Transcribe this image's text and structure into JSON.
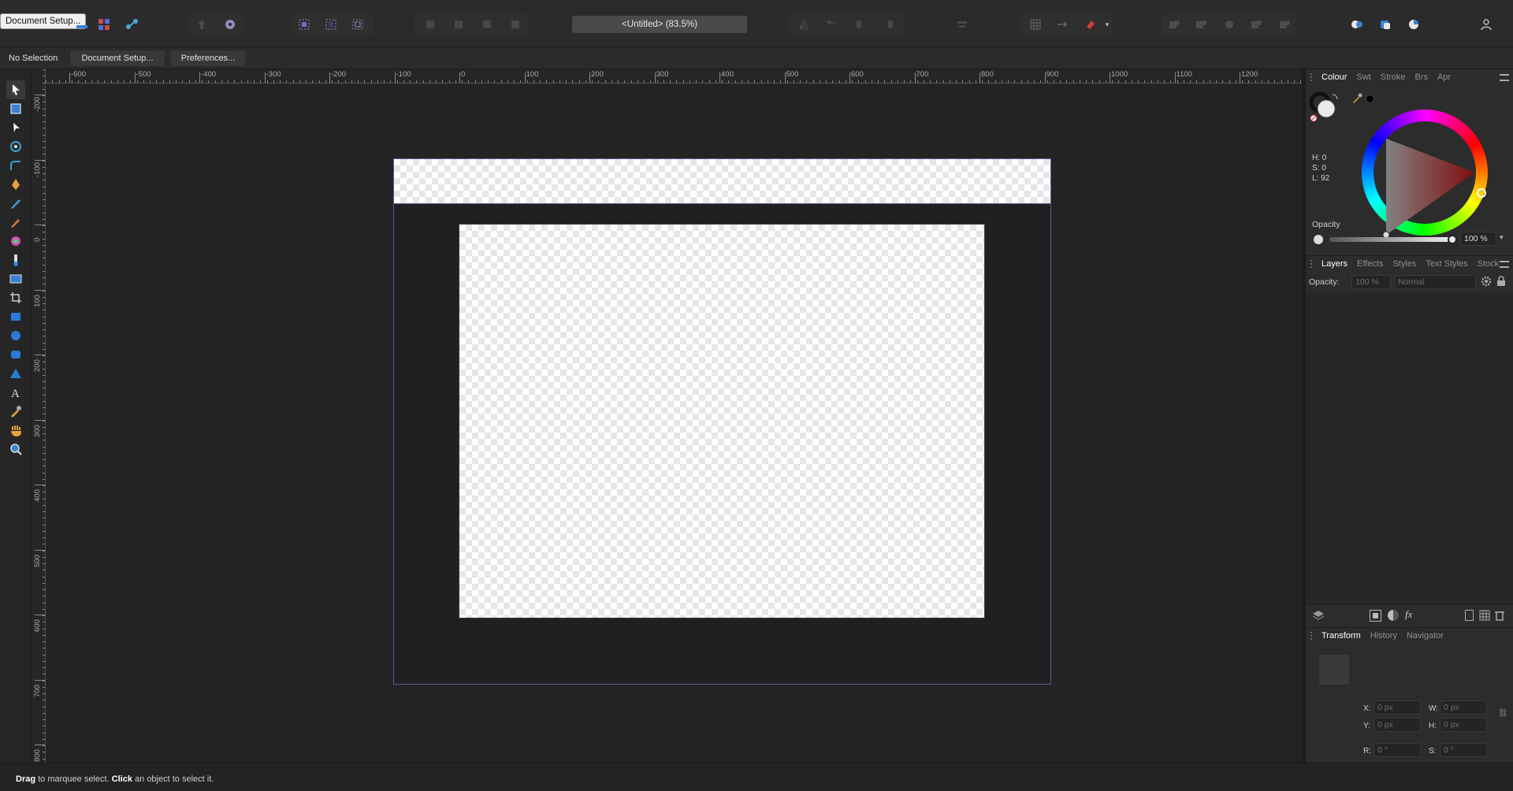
{
  "tooltip": "Document Setup...",
  "document_title": "<Untitled> (83.5%)",
  "context": {
    "selection_label": "No Selection",
    "document_setup": "Document Setup...",
    "preferences": "Preferences..."
  },
  "ruler": {
    "unit": "px",
    "h_labels": [
      "-600",
      "-500",
      "-400",
      "-300",
      "-200",
      "-100",
      "0",
      "100",
      "200",
      "300",
      "400",
      "500",
      "600",
      "700",
      "800",
      "900",
      "1000",
      "1100",
      "1200"
    ],
    "v_labels": [
      "-200",
      "-100",
      "0",
      "100",
      "200",
      "300",
      "400",
      "500",
      "600",
      "700",
      "800"
    ]
  },
  "status": {
    "drag": "Drag",
    "drag_rest": " to marquee select. ",
    "click": "Click",
    "click_rest": " an object to select it."
  },
  "colour_panel": {
    "tabs": [
      "Colour",
      "Swt",
      "Stroke",
      "Brs",
      "Apr"
    ],
    "h": "H: 0",
    "s": "S: 0",
    "l": "L: 92",
    "opacity_label": "Opacity",
    "opacity_value": "100 %"
  },
  "layers_panel": {
    "tabs": [
      "Layers",
      "Effects",
      "Styles",
      "Text Styles",
      "Stock"
    ],
    "opacity_label": "Opacity:",
    "opacity_value": "100 %",
    "blend_mode": "Normal"
  },
  "transform_panel": {
    "tabs": [
      "Transform",
      "History",
      "Navigator"
    ],
    "x_label": "X:",
    "x_value": "0 px",
    "y_label": "Y:",
    "y_value": "0 px",
    "w_label": "W:",
    "w_value": "0 px",
    "h_label": "H:",
    "h_value": "0 px",
    "r_label": "R:",
    "r_value": "0 °",
    "s_label": "S:",
    "s_value": "0 °"
  },
  "colors": {
    "accent": "#5a5a9a",
    "hue_handle": "#ff2a2a"
  }
}
